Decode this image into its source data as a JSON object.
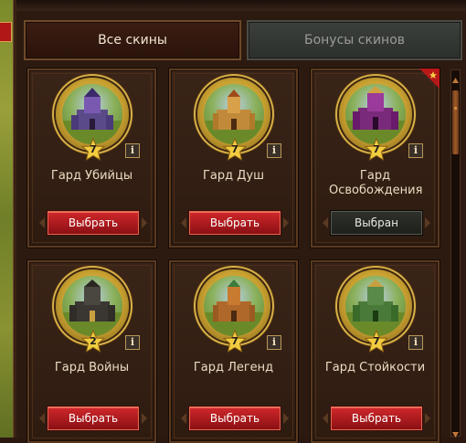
{
  "tabs": [
    {
      "label": "Все скины",
      "active": true
    },
    {
      "label": "Бонусы скинов",
      "active": false
    }
  ],
  "cards": [
    {
      "name": "Гард Убийцы",
      "level": "7",
      "button": "Выбрать",
      "state": "select",
      "accent": "#6a4aa0",
      "new": false
    },
    {
      "name": "Гард Душ",
      "level": "7",
      "button": "Выбрать",
      "state": "select",
      "accent": "#c07a2a",
      "new": false
    },
    {
      "name": "Гард Освобождения",
      "level": "7",
      "button": "Выбран",
      "state": "selected",
      "accent": "#8a2a8a",
      "new": true
    },
    {
      "name": "Гард Войны",
      "level": "2",
      "button": "Выбрать",
      "state": "select",
      "accent": "#3a3a3a",
      "new": false
    },
    {
      "name": "Гард Легенд",
      "level": "7",
      "button": "Выбрать",
      "state": "select",
      "accent": "#b0682a",
      "new": false
    },
    {
      "name": "Гард Стойкости",
      "level": "7",
      "button": "Выбрать",
      "state": "select",
      "accent": "#4a8a3a",
      "new": false
    }
  ],
  "info_label": "i",
  "colors": {
    "select_button": "#b81c20",
    "selected_button": "#262824",
    "gold": "#d8b048"
  },
  "icons": {
    "new_marker": "star-ribbon-icon",
    "level": "star-icon",
    "info": "info-icon"
  }
}
